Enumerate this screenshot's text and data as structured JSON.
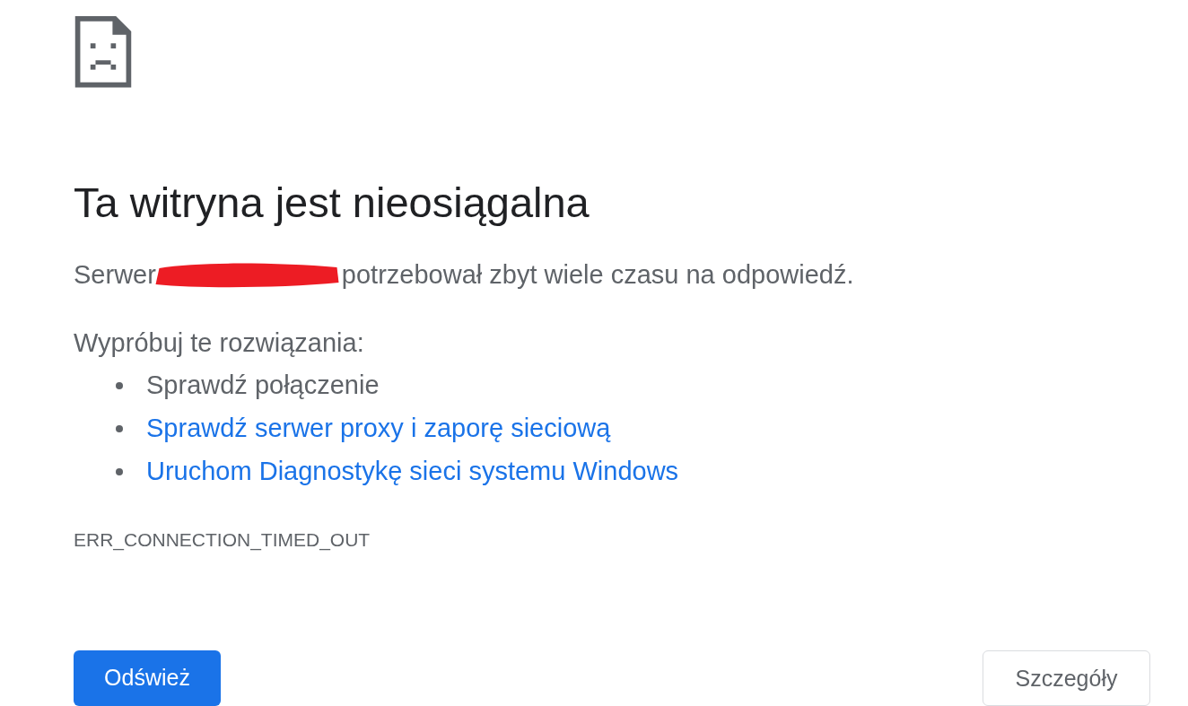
{
  "heading": "Ta witryna jest nieosiągalna",
  "message": {
    "prefix": "Serwer",
    "redacted": true,
    "suffix": "potrzebował zbyt wiele czasu na odpowiedź."
  },
  "suggestions_intro": "Wypróbuj te rozwiązania:",
  "suggestions": [
    {
      "text": "Sprawdź połączenie",
      "kind": "text"
    },
    {
      "text": "Sprawdź serwer proxy i zaporę sieciową",
      "kind": "link"
    },
    {
      "text": "Uruchom Diagnostykę sieci systemu Windows",
      "kind": "link"
    }
  ],
  "error_code": "ERR_CONNECTION_TIMED_OUT",
  "buttons": [
    {
      "label": "Odśwież",
      "kind": "primary"
    },
    {
      "label": "Szczegóły",
      "kind": "secondary"
    }
  ]
}
